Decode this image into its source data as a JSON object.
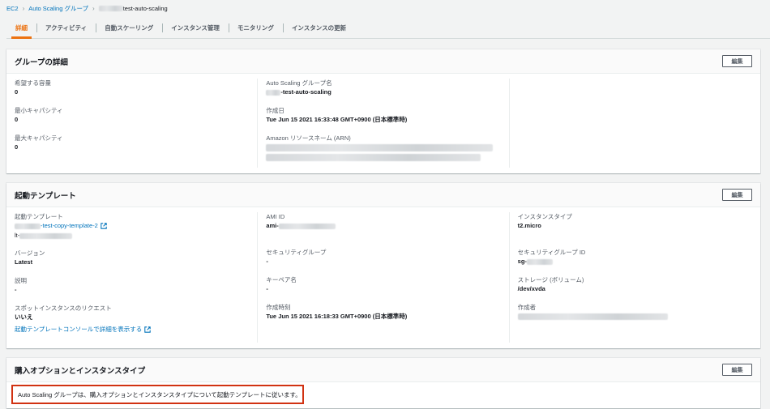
{
  "breadcrumb": {
    "root": "EC2",
    "section": "Auto Scaling グループ",
    "current_suffix": "test-auto-scaling"
  },
  "tabs": [
    {
      "label": "詳細",
      "active": true
    },
    {
      "label": "アクティビティ",
      "active": false
    },
    {
      "label": "自動スケーリング",
      "active": false
    },
    {
      "label": "インスタンス管理",
      "active": false
    },
    {
      "label": "モニタリング",
      "active": false
    },
    {
      "label": "インスタンスの更新",
      "active": false
    }
  ],
  "group_details": {
    "title": "グループの詳細",
    "edit_label": "編集",
    "desired_label": "希望する容量",
    "desired_value": "0",
    "min_label": "最小キャパシティ",
    "min_value": "0",
    "max_label": "最大キャパシティ",
    "max_value": "0",
    "name_label": "Auto Scaling グループ名",
    "name_suffix": "-test-auto-scaling",
    "created_label": "作成日",
    "created_value": "Tue Jun 15 2021 16:33:48 GMT+0900 (日本標準時)",
    "arn_label": "Amazon リソースネーム (ARN)"
  },
  "launch_template": {
    "title": "起動テンプレート",
    "edit_label": "編集",
    "template_label": "起動テンプレート",
    "template_name_suffix": "-test-copy-template-2",
    "template_id_prefix": "lt-",
    "version_label": "バージョン",
    "version_value": "Latest",
    "desc_label": "説明",
    "desc_value": "-",
    "spot_label": "スポットインスタンスのリクエスト",
    "spot_value": "いいえ",
    "console_link": "起動テンプレートコンソールで詳細を表示する",
    "ami_label": "AMI ID",
    "ami_prefix": "ami-",
    "sg_label": "セキュリティグループ",
    "sg_value": "-",
    "keypair_label": "キーペア名",
    "keypair_value": "-",
    "created_time_label": "作成時刻",
    "created_time_value": "Tue Jun 15 2021 16:18:33 GMT+0900 (日本標準時)",
    "instance_type_label": "インスタンスタイプ",
    "instance_type_value": "t2.micro",
    "sg_id_label": "セキュリティグループ ID",
    "sg_id_prefix": "sg-",
    "storage_label": "ストレージ (ボリューム)",
    "storage_value": "/dev/xvda",
    "creator_label": "作成者"
  },
  "purchase_options": {
    "title": "購入オプションとインスタンスタイプ",
    "edit_label": "編集",
    "info": "Auto Scaling グループは、購入オプションとインスタンスタイプについて起動テンプレートに従います。"
  },
  "icons": {
    "external_link": "external-link-icon",
    "chevron": "chevron-right-icon"
  },
  "colors": {
    "accent": "#ec7211",
    "link": "#0073bb",
    "highlight_border": "#d13212"
  }
}
